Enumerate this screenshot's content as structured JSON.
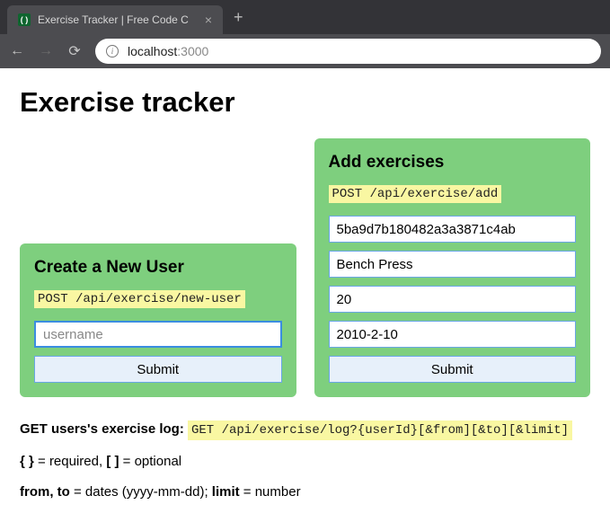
{
  "browser": {
    "tab_title": "Exercise Tracker | Free Code C",
    "url_host": "localhost",
    "url_port": ":3000"
  },
  "page": {
    "heading": "Exercise tracker"
  },
  "create_user": {
    "title": "Create a New User",
    "endpoint": "POST /api/exercise/new-user",
    "username_value": "",
    "username_placeholder": "username",
    "submit_label": "Submit"
  },
  "add_exercise": {
    "title": "Add exercises",
    "endpoint": "POST /api/exercise/add",
    "user_id_value": "5ba9d7b180482a3a3871c4ab",
    "description_value": "Bench Press",
    "duration_value": "20",
    "date_value": "2010-2-10",
    "submit_label": "Submit"
  },
  "docs": {
    "log_label": "GET users's exercise log: ",
    "log_endpoint": "GET /api/exercise/log?{userId}[&from][&to][&limit]",
    "required_symbol": "{ }",
    "required_text": " = required, ",
    "optional_symbol": "[ ]",
    "optional_text": " = optional",
    "from_to_label": "from, to",
    "from_to_text": " = dates (yyyy-mm-dd); ",
    "limit_label": "limit",
    "limit_text": " = number"
  }
}
